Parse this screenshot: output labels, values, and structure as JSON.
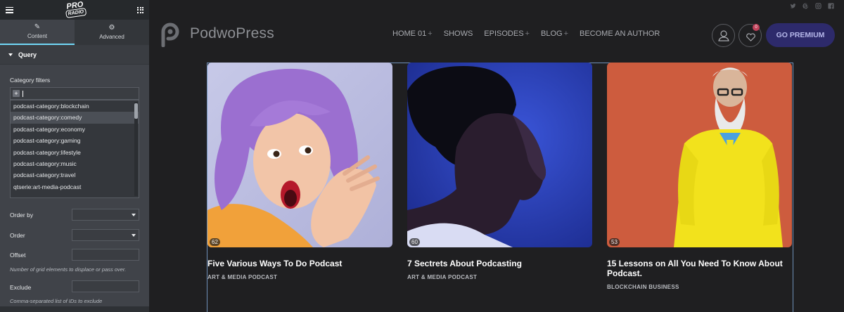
{
  "panel": {
    "logo": {
      "line1": "PRO",
      "line2": "RADIO"
    },
    "tabs": [
      {
        "label": "Content",
        "icon": "pencil-icon"
      },
      {
        "label": "Advanced",
        "icon": "gear-icon"
      }
    ],
    "section_title": "Query",
    "category_filters_label": "Category filters",
    "category_options": [
      "podcast-category:blockchain",
      "podcast-category:comedy",
      "podcast-category:economy",
      "podcast-category:gaming",
      "podcast-category:lifestyle",
      "podcast-category:music",
      "podcast-category:travel",
      "qtserie:art-media-podcast"
    ],
    "highlighted_option_index": 1,
    "order_by_label": "Order by",
    "order_label": "Order",
    "offset_label": "Offset",
    "offset_hint": "Number of grid elements to displace or pass over.",
    "exclude_label": "Exclude",
    "exclude_hint": "Comma-separated list of IDs to exclude",
    "collapse_glyph": "‹"
  },
  "site": {
    "social_icons": [
      "twitter-icon",
      "pinterest-icon",
      "instagram-icon",
      "facebook-icon"
    ],
    "brand": "PodwoPress",
    "nav": [
      {
        "label": "HOME 01",
        "has_plus": true
      },
      {
        "label": "SHOWS",
        "has_plus": false
      },
      {
        "label": "EPISODES",
        "has_plus": true
      },
      {
        "label": "BLOG",
        "has_plus": true
      },
      {
        "label": "BECOME AN AUTHOR",
        "has_plus": false
      }
    ],
    "plus_glyph": "+",
    "favorites_count": "0",
    "premium_label": "GO PREMIUM",
    "cards": [
      {
        "count": "62",
        "title": "Five Various Ways To Do Podcast",
        "category": "ART & MEDIA PODCAST"
      },
      {
        "count": "60",
        "title": "7 Sectrets About Podcasting",
        "category": "ART & MEDIA PODCAST"
      },
      {
        "count": "53",
        "title": "15 Lessons on All You Need To Know About Podcast.",
        "category": "BLOCKCHAIN BUSINESS"
      }
    ]
  },
  "colors": {
    "accent_tab": "#71d7f7",
    "premium_bg": "#2d2a6b",
    "badge": "#c0415a"
  }
}
